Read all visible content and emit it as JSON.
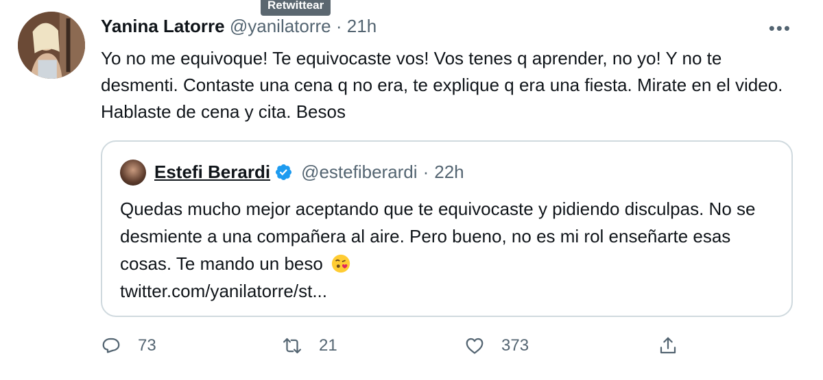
{
  "tooltip": "Retwittear",
  "tweet": {
    "name": "Yanina Latorre",
    "handle": "@yanilatorre",
    "separator": "·",
    "time": "21h",
    "more_icon": "more-icon",
    "text": "Yo no me equivoque! Te equivocaste vos! Vos tenes q aprender, no yo! Y no te desmenti. Contaste una cena q no era, te explique q era una fiesta. Mirate en el video. Hablaste de cena y cita. Besos"
  },
  "quote": {
    "name": "Estefi Berardi",
    "verified_icon": "verified-badge-icon",
    "handle": "@estefiberardi",
    "separator": "·",
    "time": "22h",
    "text": "Quedas mucho mejor aceptando que te equivocaste y pidiendo disculpas. No se desmiente a una compañera al aire. Pero bueno, no es mi rol enseñarte esas cosas. Te mando un beso",
    "emoji_icon": "kissing-face-emoji-icon",
    "link": "twitter.com/yanilatorre/st..."
  },
  "actions": {
    "reply_count": "73",
    "retweet_count": "21",
    "like_count": "373"
  },
  "colors": {
    "text": "#0f1419",
    "muted": "#536471",
    "border": "#cfd9de",
    "verified": "#1d9bf0",
    "tooltip_bg": "#5b6770"
  }
}
